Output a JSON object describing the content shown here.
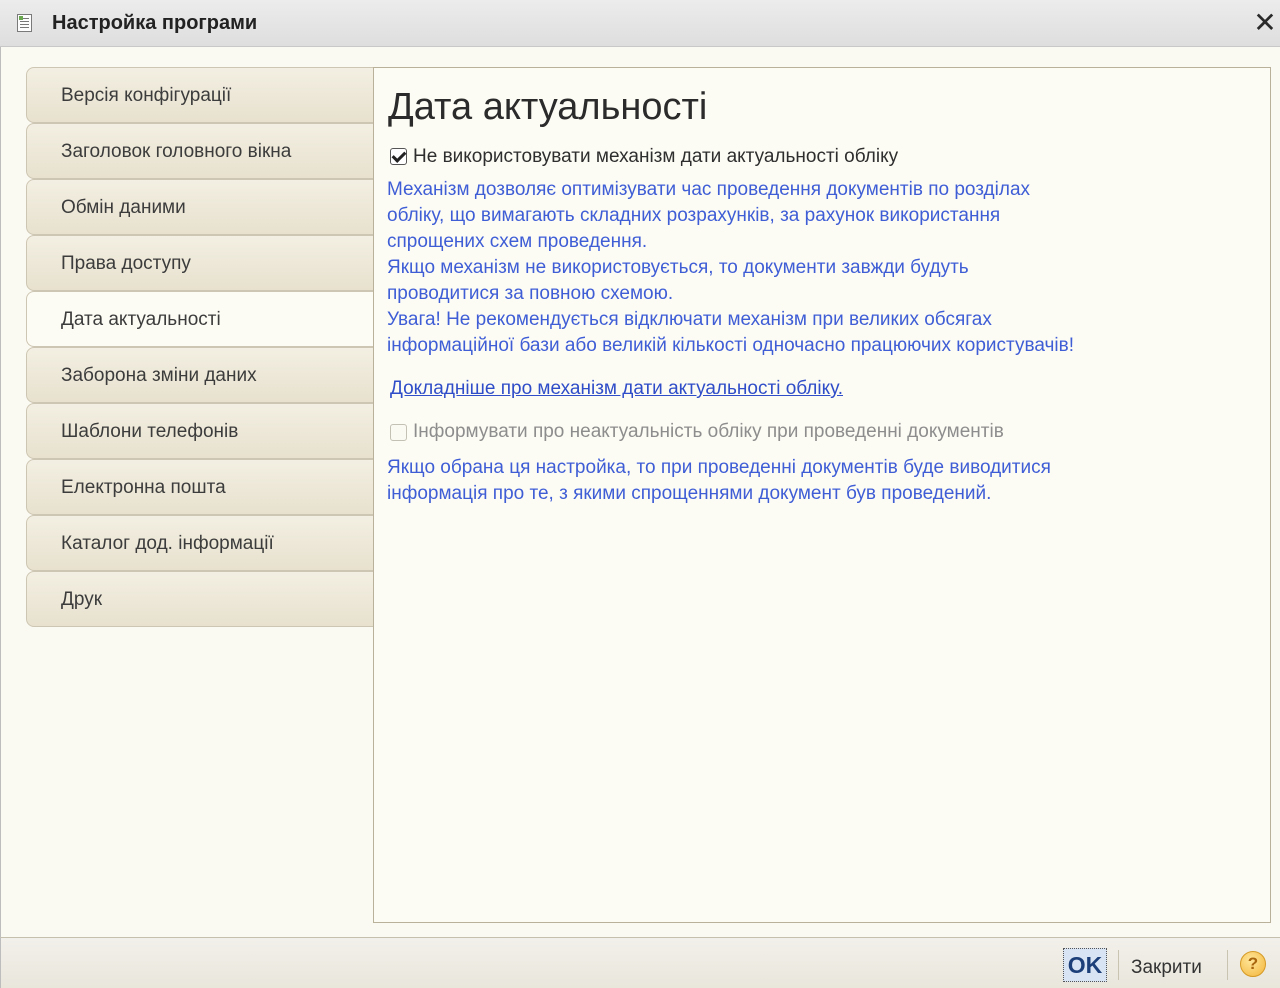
{
  "window": {
    "title": "Настройка програми",
    "icon": "settings-document-icon",
    "close_glyph": "✕"
  },
  "tabs": [
    {
      "label": "Версія конфігурації",
      "active": false
    },
    {
      "label": "Заголовок головного вікна",
      "active": false
    },
    {
      "label": "Обмін даними",
      "active": false
    },
    {
      "label": "Права доступу",
      "active": false
    },
    {
      "label": "Дата актуальності",
      "active": true
    },
    {
      "label": "Заборона зміни даних",
      "active": false
    },
    {
      "label": "Шаблони телефонів",
      "active": false
    },
    {
      "label": "Електронна пошта",
      "active": false
    },
    {
      "label": "Каталог дод. інформації",
      "active": false
    },
    {
      "label": "Друк",
      "active": false
    }
  ],
  "content": {
    "heading": "Дата актуальності",
    "checkbox1": {
      "label": "Не використовувати механізм дати актуальності обліку",
      "checked": true
    },
    "description1": "Механізм дозволяє оптимізувати час проведення документів по розділах\nобліку, що вимагають складних розрахунків, за рахунок використання\nспрощених схем проведення.\nЯкщо механізм не використовується, то документи завжди будуть\nпроводитися за повною схемою.\nУвага! Не рекомендується відключати механізм при великих обсягах\nінформаційної бази або великій  кількості одночасно працюючих користувачів!",
    "link": "Докладніше про механізм дати актуальності обліку.",
    "checkbox2": {
      "label": "Інформувати про неактуальність обліку при проведенні документів",
      "checked": false,
      "disabled": true
    },
    "description2": "Якщо обрана ця настройка, то при проведенні документів буде виводитися\nінформація про те, з якими спрощеннями документ був проведений."
  },
  "footer": {
    "ok_label": "OK",
    "close_label": "Закрити",
    "help_glyph": "?"
  },
  "colors": {
    "description_text": "#3f5ed6",
    "link": "#2f4dc8",
    "panel_background": "#fdfcf4"
  }
}
